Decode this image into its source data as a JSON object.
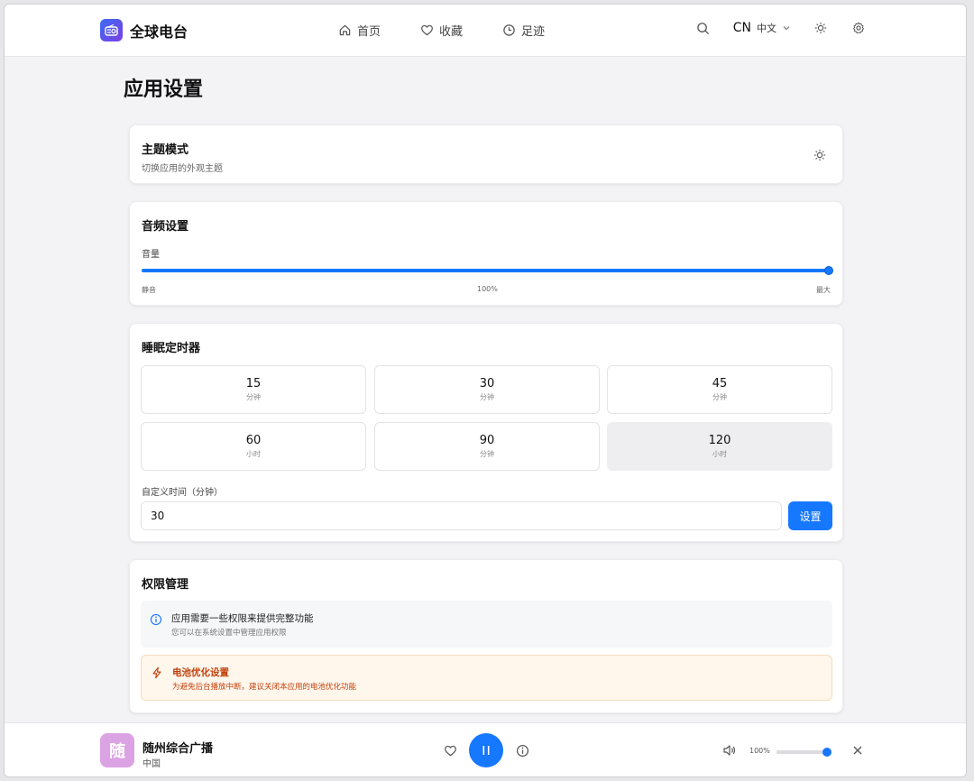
{
  "header": {
    "brand": "全球电台",
    "nav": [
      {
        "label": "首页",
        "icon": "home-icon"
      },
      {
        "label": "收藏",
        "icon": "heart-icon"
      },
      {
        "label": "足迹",
        "icon": "clock-icon"
      }
    ],
    "lang_code": "CN",
    "lang_name": "中文"
  },
  "page_title": "应用设置",
  "theme": {
    "title": "主题模式",
    "subtitle": "切换应用的外观主题"
  },
  "audio": {
    "title": "音频设置",
    "volume_label": "音量",
    "min_label": "静音",
    "value_label": "100%",
    "max_label": "最大",
    "volume": 100
  },
  "sleep": {
    "title": "睡眠定时器",
    "options": [
      {
        "value": "15",
        "unit": "分钟"
      },
      {
        "value": "30",
        "unit": "分钟"
      },
      {
        "value": "45",
        "unit": "分钟"
      },
      {
        "value": "60",
        "unit": "小时"
      },
      {
        "value": "90",
        "unit": "分钟"
      },
      {
        "value": "120",
        "unit": "小时"
      }
    ],
    "selected_index": 5,
    "custom_label": "自定义时间（分钟）",
    "custom_value": "30",
    "set_label": "设置"
  },
  "permissions": {
    "title": "权限管理",
    "info_title": "应用需要一些权限来提供完整功能",
    "info_sub": "您可以在系统设置中管理应用权限",
    "warn_title": "电池优化设置",
    "warn_sub": "为避免后台播放中断，建议关闭本应用的电池优化功能"
  },
  "player": {
    "logo_char": "随",
    "station": "随州综合广播",
    "country": "中国",
    "volume_label": "100%",
    "volume": 100
  },
  "colors": {
    "accent": "#1677ff",
    "warn": "#c2410c",
    "station_logo": "#dca3e4"
  }
}
